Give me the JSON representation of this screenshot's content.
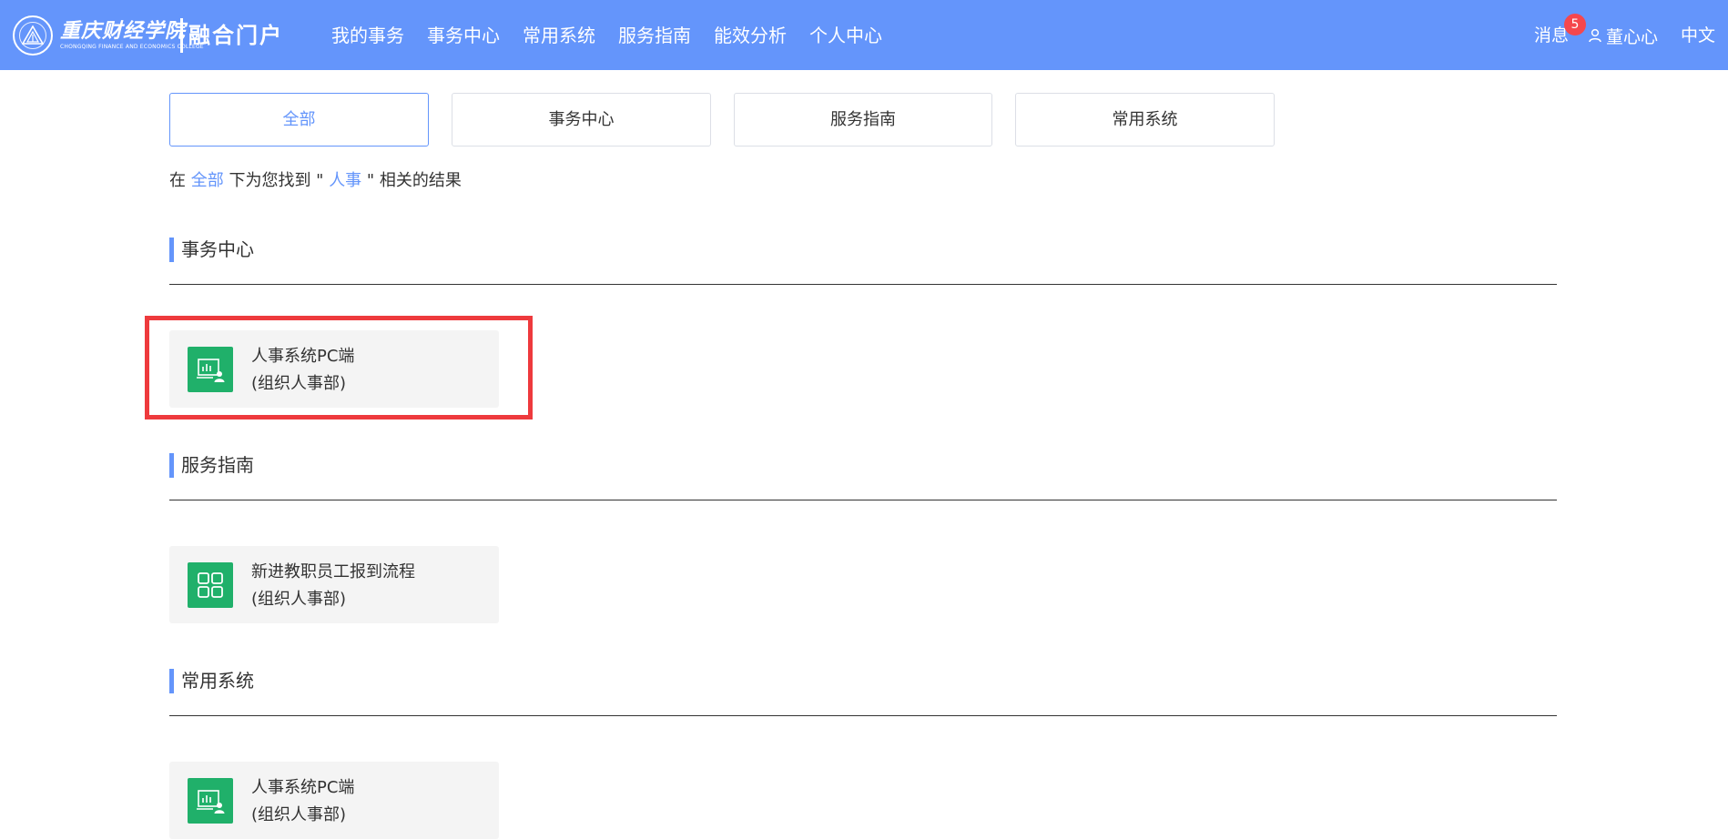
{
  "header": {
    "school_name": "重庆财经学院",
    "school_en": "CHONGQING FINANCE AND ECONOMICS COLLEGE",
    "portal_name": "融合门户",
    "nav": [
      "我的事务",
      "事务中心",
      "常用系统",
      "服务指南",
      "能效分析",
      "个人中心"
    ],
    "messages_label": "消息",
    "messages_count": "5",
    "user_name": "董心心",
    "language": "中文"
  },
  "tabs": [
    {
      "label": "全部",
      "active": true
    },
    {
      "label": "事务中心",
      "active": false
    },
    {
      "label": "服务指南",
      "active": false
    },
    {
      "label": "常用系统",
      "active": false
    }
  ],
  "summary": {
    "prefix": "在 ",
    "scope": "全部",
    "middle": " 下为您找到 \" ",
    "keyword": "人事",
    "suffix": " \" 相关的结果"
  },
  "sections": [
    {
      "title": "事务中心",
      "items": [
        {
          "title": "人事系统PC端",
          "dept": "(组织人事部)",
          "icon": "chart-person-icon"
        }
      ]
    },
    {
      "title": "服务指南",
      "items": [
        {
          "title": "新进教职员工报到流程",
          "dept": "(组织人事部)",
          "icon": "grid-icon"
        }
      ]
    },
    {
      "title": "常用系统",
      "items": [
        {
          "title": "人事系统PC端",
          "dept": "(组织人事部)",
          "icon": "chart-person-icon"
        }
      ]
    }
  ],
  "colors": {
    "header_bg": "#6495fb",
    "accent": "#6495fb",
    "icon_bg": "#20b06a",
    "badge": "#f5474d",
    "highlight": "#ee3a3d"
  }
}
